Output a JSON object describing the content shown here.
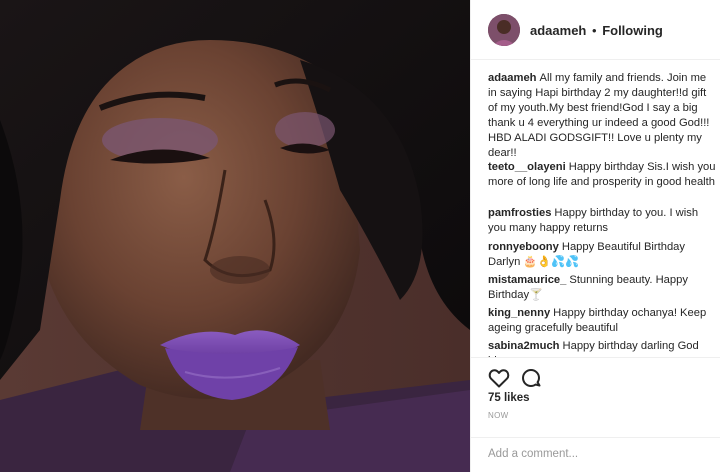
{
  "post": {
    "username": "adaameh",
    "separator": "•",
    "follow_status": "Following"
  },
  "comments": [
    {
      "user": "adaameh",
      "text": "All my family and friends. Join me in saying Hapi birthday 2 my daughter!!d gift of my youth.My best friend!God I say a big thank u 4 everything ur indeed a good God!!! HBD ALADI GODSGIFT!! Love u plenty my dear!!"
    },
    {
      "user": "teeto__olayeni",
      "text": "Happy birthday Sis.I wish you more of long life and prosperity in good health"
    },
    {
      "user": "pamfrosties",
      "text": "Happy birthday to you. I wish you many happy returns"
    },
    {
      "user": "ronnyeboony",
      "text": "Happy Beautiful Birthday Darlyn 🎂👌💦💦"
    },
    {
      "user": "mistamaurice_",
      "text": "Stunning beauty. Happy Birthday🍸"
    },
    {
      "user": "king_nenny",
      "text": "Happy birthday ochanya! Keep ageing gracefully beautiful"
    },
    {
      "user": "sabina2much",
      "text": "Happy birthday darling God bless you"
    }
  ],
  "actions": {
    "like_icon": "heart-icon",
    "comment_icon": "comment-icon",
    "likes_text": "75 likes",
    "time_text": "NOW"
  },
  "add_comment": {
    "placeholder": "Add a comment..."
  },
  "colors": {
    "text": "#262626",
    "muted": "#999999",
    "divider": "#efefef",
    "lip_purple": "#7b4ab0"
  }
}
